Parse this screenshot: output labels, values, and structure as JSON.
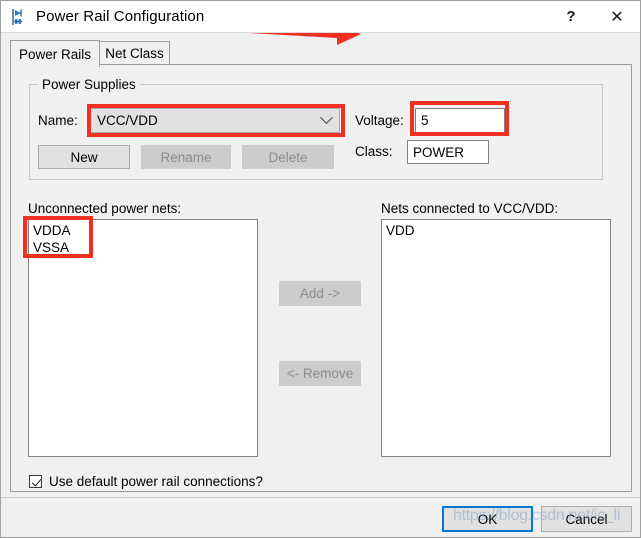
{
  "window": {
    "title": "Power Rail Configuration",
    "icon": "power-rail-icon",
    "help_label": "?",
    "close_label": "✕"
  },
  "tabs": [
    {
      "label": "Power Rails",
      "active": true
    },
    {
      "label": "Net Class",
      "active": false
    }
  ],
  "power_supplies": {
    "group_title": "Power Supplies",
    "name_label": "Name:",
    "name_value": "VCC/VDD",
    "voltage_label": "Voltage:",
    "voltage_value": "5",
    "class_label": "Class:",
    "class_value": "POWER",
    "buttons": {
      "new": "New",
      "rename": "Rename",
      "delete": "Delete"
    }
  },
  "lists": {
    "left_label": "Unconnected power nets:",
    "left_items": [
      "VDDA",
      "VSSA"
    ],
    "right_label": "Nets connected to VCC/VDD:",
    "right_items": [
      "VDD"
    ]
  },
  "transfer_buttons": {
    "add": "Add ->",
    "remove": "<- Remove"
  },
  "options": {
    "use_default_label": "Use default power rail connections?",
    "use_default_checked": true
  },
  "dialog_buttons": {
    "ok": "OK",
    "cancel": "Cancel"
  },
  "watermark": {
    "text": "https://blog.csdn.net/ic_li"
  },
  "colors": {
    "annotation_red": "#f23022",
    "focus_blue": "#0078d7",
    "window_bg": "#f0f0f0",
    "field_bg": "#ffffff"
  }
}
